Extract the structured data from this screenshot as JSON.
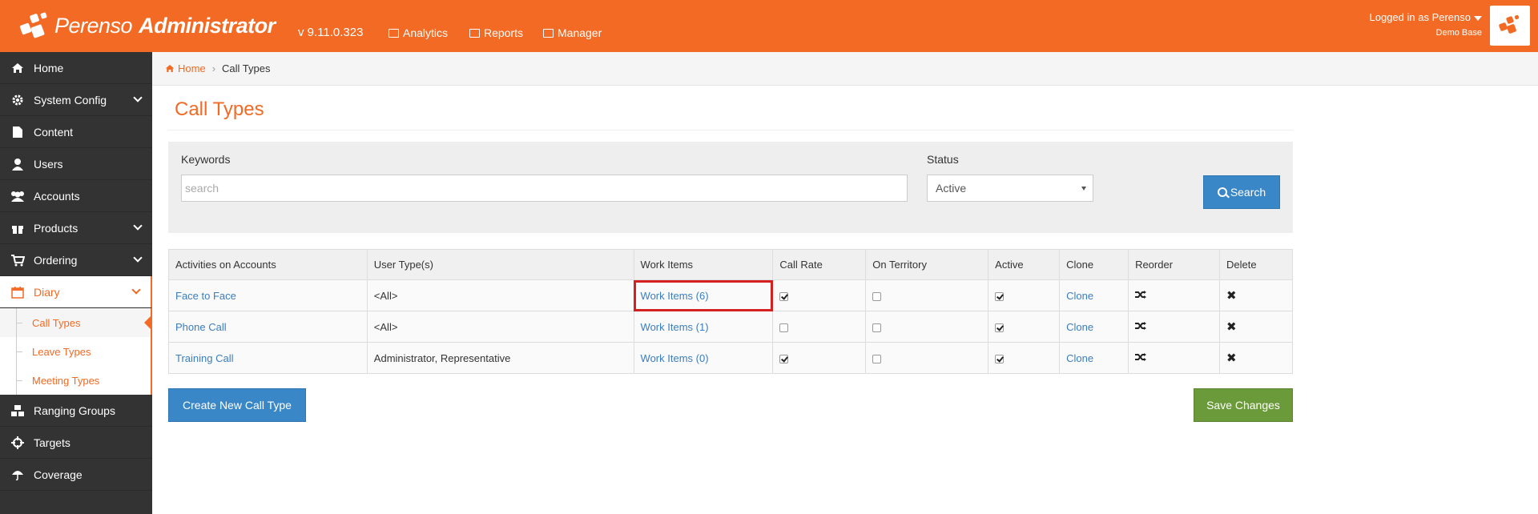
{
  "header": {
    "brand_name": "Perenso",
    "brand_suffix": "Administrator",
    "version": "v 9.11.0.323",
    "nav": [
      {
        "label": "Analytics",
        "icon": "chart-icon"
      },
      {
        "label": "Reports",
        "icon": "table-icon"
      },
      {
        "label": "Manager",
        "icon": "briefcase-icon"
      }
    ],
    "user_label": "Logged in as Perenso",
    "database": "Demo Base"
  },
  "sidebar": {
    "items": [
      {
        "label": "Home",
        "icon": "home-icon",
        "expandable": false
      },
      {
        "label": "System Config",
        "icon": "gear-icon",
        "expandable": true
      },
      {
        "label": "Content",
        "icon": "file-icon",
        "expandable": false
      },
      {
        "label": "Users",
        "icon": "user-icon",
        "expandable": false
      },
      {
        "label": "Accounts",
        "icon": "users-icon",
        "expandable": false
      },
      {
        "label": "Products",
        "icon": "gift-icon",
        "expandable": true
      },
      {
        "label": "Ordering",
        "icon": "cart-icon",
        "expandable": true
      },
      {
        "label": "Diary",
        "icon": "calendar-icon",
        "expandable": true,
        "active": true
      },
      {
        "label": "Ranging Groups",
        "icon": "cubes-icon",
        "expandable": false
      },
      {
        "label": "Targets",
        "icon": "crosshairs-icon",
        "expandable": false
      },
      {
        "label": "Coverage",
        "icon": "umbrella-icon",
        "expandable": false
      }
    ],
    "diary_sub": [
      "Call Types",
      "Leave Types",
      "Meeting Types"
    ]
  },
  "breadcrumb": {
    "home": "Home",
    "current": "Call Types"
  },
  "page_title": "Call Types",
  "filters": {
    "keywords_label": "Keywords",
    "keywords_placeholder": "search",
    "status_label": "Status",
    "status_value": "Active",
    "search_label": "Search"
  },
  "table": {
    "columns": [
      "Activities on Accounts",
      "User Type(s)",
      "Work Items",
      "Call Rate",
      "On Territory",
      "Active",
      "Clone",
      "Reorder",
      "Delete"
    ],
    "rows": [
      {
        "activity": "Face to Face",
        "user_types": "<All>",
        "work_items": "Work Items (6)",
        "call_rate": true,
        "on_territory": false,
        "active": true,
        "clone": "Clone"
      },
      {
        "activity": "Phone Call",
        "user_types": "<All>",
        "work_items": "Work Items (1)",
        "call_rate": false,
        "on_territory": false,
        "active": true,
        "clone": "Clone"
      },
      {
        "activity": "Training Call",
        "user_types": "Administrator, Representative",
        "work_items": "Work Items (0)",
        "call_rate": true,
        "on_territory": false,
        "active": true,
        "clone": "Clone"
      }
    ]
  },
  "buttons": {
    "create": "Create New Call Type",
    "save": "Save Changes"
  },
  "colors": {
    "brand": "#f26a24",
    "primary": "#3a87c8",
    "success": "#6b9a3b",
    "sidebar": "#333333"
  }
}
